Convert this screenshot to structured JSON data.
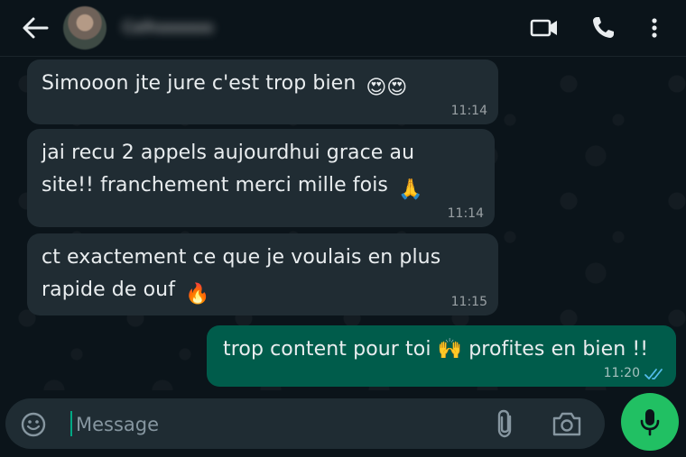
{
  "header": {
    "contact_name": "Celhoooooo",
    "back_icon": "arrow-left-icon",
    "video_icon": "video-call-icon",
    "call_icon": "phone-icon",
    "menu_icon": "more-vertical-icon"
  },
  "messages": [
    {
      "direction": "in",
      "text": "Simooon jte jure c'est trop bien",
      "emoji": "😍😍",
      "time": "11:14"
    },
    {
      "direction": "in",
      "text": "jai recu 2 appels aujourdhui grace au\nsite!! franchement merci mille fois",
      "emoji": "🙏",
      "time": "11:14"
    },
    {
      "direction": "in",
      "text": "ct exactement ce que je voulais en plus\nrapide de ouf",
      "emoji": "🔥",
      "time": "11:15"
    },
    {
      "direction": "out",
      "text": "trop content pour toi 🙌 profites en bien !!",
      "time": "11:20",
      "status": "read"
    }
  ],
  "composer": {
    "placeholder": "Message",
    "value": ""
  },
  "colors": {
    "background": "#0b141a",
    "incoming_bubble": "#202c33",
    "outgoing_bubble": "#005c4b",
    "accent_green": "#21c063",
    "read_ticks": "#53bdeb"
  }
}
